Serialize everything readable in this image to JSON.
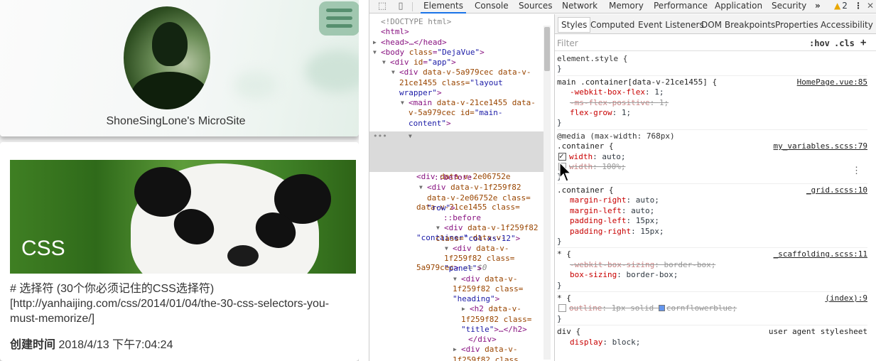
{
  "site": {
    "title": "ShoneSingLone's MicroSite",
    "hero_label": "CSS",
    "summary_line1": "# 选择符 (30个你必须记住的CSS选择符)",
    "summary_line2": "[http://yanhaijing.com/css/2014/01/04/the-30-css-selectors-you-",
    "summary_line3": "must-memorize/]",
    "meta_label": "创建时间",
    "meta_value": "2018/4/13 下午7:04:24"
  },
  "devtools": {
    "tabs": [
      "Elements",
      "Console",
      "Sources",
      "Network",
      "Memory",
      "Performance",
      "Application",
      "Security"
    ],
    "more": "»",
    "warning_count": "2",
    "kebab": "⋮",
    "close": "✕",
    "dom": {
      "doctype": "<!DOCTYPE html>",
      "html_open": "<html>",
      "head": "<head>…</head>",
      "body_tag": "body",
      "body_class": "DejaVue",
      "app_id": "app",
      "layout_attrs1": "data-v-5a979cec data-v-",
      "layout_attrs2": "21ce1455 class=",
      "layout_class": "\"layout",
      "layout_class2": "wrapper\"",
      "main_attrs1": "data-v-21ce1455 data-",
      "main_attrs2": "v-5a979cec id=",
      "main_id": "\"main-",
      "main_id2": "content\"",
      "container_attrs1": "data-v-2e06752e",
      "container_attrs2": "data-v-21ce1455 class=",
      "container_class": "\"container\"",
      "container_attrs3": "data-v-",
      "container_attrs4": "5a979cec",
      "eq": "== $0",
      "before": "::before",
      "row_attrs1": "data-v-1f259f82",
      "row_attrs2": "data-v-2e06752e class=",
      "row_class": "\"row\"",
      "col_attrs1": "data-v-1f259f82",
      "col_attrs2": "class=",
      "col_class": "\"col-xs-12\"",
      "panel_attrs1": "data-v-",
      "panel_attrs2": "1f259f82 class=",
      "panel_class": "\"panel\"",
      "heading_attrs1": "data-v-",
      "heading_attrs2": "1f259f82 class=",
      "heading_class": "\"heading\"",
      "h2_attrs1": "data-v-",
      "h2_attrs2": "1f259f82 class=",
      "h2_class": "\"title\"",
      "h2_tail": "…</h2>",
      "div_close": "</div>",
      "last_attrs1": "data-v-",
      "last_attrs2": "1f259f82 class"
    },
    "styles": {
      "subtabs": [
        "Styles",
        "Computed",
        "Event Listeners",
        "DOM Breakpoints",
        "Properties",
        "Accessibility"
      ],
      "filter_placeholder": "Filter",
      "hov": ":hov",
      "cls": ".cls",
      "plus": "+",
      "element_style": "element.style {",
      "close_brace": "}",
      "r1_selector": "main .container[data-v-21ce1455] {",
      "r1_source": "HomePage.vue:85",
      "r1_p1": "-webkit-box-flex",
      "r1_v1": "1;",
      "r1_p2": "-ms-flex-positive",
      "r1_v2": "1;",
      "r1_p3": "flex-grow",
      "r1_v3": "1;",
      "media": "@media (max-width: 768px)",
      "r2_selector": ".container {",
      "r2_source": "my_variables.scss:79",
      "r2_p1": "width",
      "r2_v1": "auto;",
      "r2_p2": "width",
      "r2_v2": "100%;",
      "r3_selector": ".container {",
      "r3_source": "_grid.scss:10",
      "r3_p1": "margin-right",
      "r3_v1": "auto;",
      "r3_p2": "margin-left",
      "r3_v2": "auto;",
      "r3_p3": "padding-left",
      "r3_v3": "15px;",
      "r3_p4": "padding-right",
      "r3_v4": "15px;",
      "r4_selector": "* {",
      "r4_source": "_scaffolding.scss:11",
      "r4_p1": "-webkit-box-sizing",
      "r4_v1": "border-box;",
      "r4_p2": "box-sizing",
      "r4_v2": "border-box;",
      "r5_selector": "* {",
      "r5_source": "(index):9",
      "r5_p1": "outline",
      "r5_v1a": "1px solid",
      "r5_v1b": "cornflowerblue;",
      "r6_selector": "div {",
      "r6_source": "user agent stylesheet",
      "r6_p1": "display",
      "r6_v1": "block;"
    }
  },
  "colors": {
    "accent": "#1a73e8",
    "tag": "#881280",
    "attr": "#994500",
    "value": "#1a1aa6",
    "property": "#c80000",
    "swatch": "#6495ed"
  }
}
